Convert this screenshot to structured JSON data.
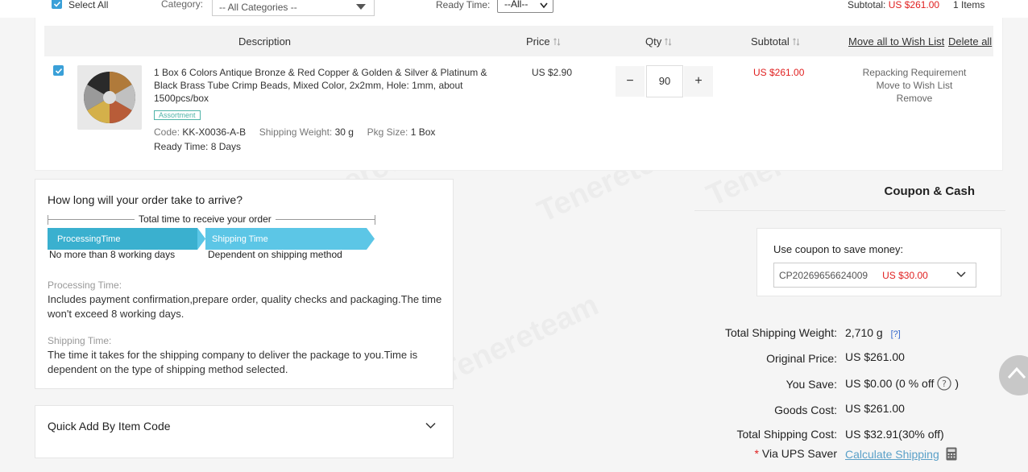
{
  "filterbar": {
    "select_all": "Select All",
    "category_label": "Category:",
    "category_value": "-- All Categories --",
    "ready_time_label": "Ready Time:",
    "ready_time_value": "--All--",
    "subtotal_label": "Subtotal:",
    "subtotal_value": "US $261.00",
    "items_count": "1 Items"
  },
  "table": {
    "headers": {
      "description": "Description",
      "price": "Price",
      "qty": "Qty",
      "subtotal": "Subtotal",
      "move_all": "Move all to Wish List",
      "delete_all": "Delete all"
    },
    "row": {
      "title": "1 Box 6 Colors Antique Bronze & Red Copper & Golden & Silver & Platinum & Black Brass Tube Crimp Beads, Mixed Color, 2x2mm, Hole: 1mm, about 1500pcs/box",
      "tag": "Assortment",
      "code_label": "Code:",
      "code_value": "KK-X0036-A-B",
      "weight_label": "Shipping Weight:",
      "weight_value": "30 g",
      "pkg_label": "Pkg Size:",
      "pkg_value": "1 Box",
      "ready_label": "Ready Time:",
      "ready_value": "8 Days",
      "price": "US $2.90",
      "qty": "90",
      "minus": "−",
      "plus": "+",
      "subtotal": "US $261.00",
      "action_repack": "Repacking Requirement",
      "action_wish": "Move to Wish List",
      "action_remove": "Remove"
    }
  },
  "arrival": {
    "title": "How long will your order take to arrive?",
    "total_label": "Total time to receive your order",
    "processing_arrow": "ProcessingTime",
    "shipping_arrow": "Shipping Time",
    "processing_sub": "No more than 8 working days",
    "shipping_sub": "Dependent on shipping method",
    "processing_heading": "Processing Time:",
    "processing_text": "Includes payment confirmation,prepare order, quality checks and packaging.The time won't exceed 8 working days.",
    "shipping_heading": "Shipping Time:",
    "shipping_text": "The time it takes for the shipping company to deliver the package to you.Time is dependent on the type of shipping method selected."
  },
  "quickadd": {
    "label": "Quick Add By Item Code"
  },
  "coupon": {
    "title": "Coupon & Cash",
    "use_label": "Use coupon to save money:",
    "code": "CP20269656624009",
    "amount": "US $30.00"
  },
  "summary": {
    "weight_label": "Total Shipping Weight:",
    "weight_value": "2,710 g",
    "weight_help": "[?]",
    "original_label": "Original Price:",
    "original_value": "US $261.00",
    "save_label": "You Save:",
    "save_value": "US $0.00",
    "save_pct_open": "(0 % off",
    "save_pct_close": ")",
    "goods_label": "Goods Cost:",
    "goods_value": "US $261.00",
    "ship_label": "Total Shipping Cost:",
    "ship_value": "US $32.91(30% off)",
    "via_star": "*",
    "via_label": "Via UPS Saver",
    "calc_link": "Calculate Shipping"
  },
  "watermark": "Tenereteam",
  "colors": {
    "accent_blue": "#3aa0d8",
    "price_red": "#e02020",
    "arrow_processing": "#3ab0cf",
    "arrow_shipping": "#5cc6e6"
  }
}
